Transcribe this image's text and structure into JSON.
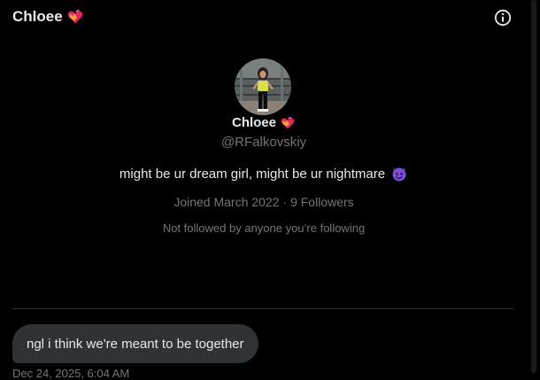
{
  "header": {
    "title": "Chloee",
    "title_emoji": "heart-on-fire-emoji",
    "info_icon": "info-circle-icon"
  },
  "profile": {
    "avatar": "profile-avatar",
    "name": "Chloee",
    "name_emoji": "heart-on-fire-emoji",
    "handle": "@RFalkovskiy",
    "bio": "might be ur dream girl, might be ur nightmare",
    "bio_emoji": "smiling-imp-emoji",
    "joined": "Joined March 2022",
    "separator": "·",
    "followers": "9 Followers",
    "followed_by": "Not followed by anyone you’re following"
  },
  "conversation": {
    "message_text": "ngl i think we're meant to be together",
    "timestamp": "Dec 24, 2025, 6:04 AM"
  },
  "colors": {
    "background": "#000000",
    "primary_text": "#e7e9ea",
    "secondary_text": "#71767b",
    "bubble_bg": "#2f3336",
    "divider": "#2f3336",
    "emoji_purple": "#7b4fd6"
  }
}
